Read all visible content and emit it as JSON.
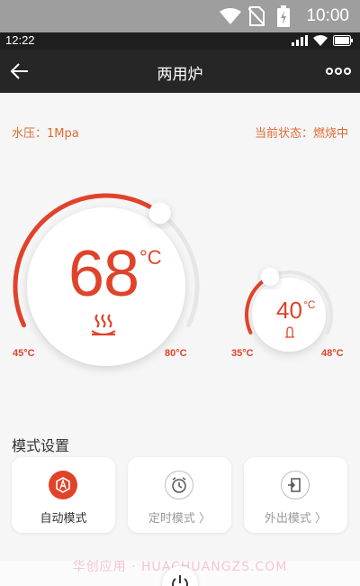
{
  "system_status": {
    "time": "10:00"
  },
  "app_status": {
    "time": "12:22"
  },
  "header": {
    "title": "两用炉"
  },
  "info": {
    "water_pressure": "水压：1Mpa",
    "current_status": "当前状态：燃烧中"
  },
  "heating_dial": {
    "temperature": "68",
    "unit": "°C",
    "min_label": "45°C",
    "max_label": "80°C",
    "min_value": 45,
    "max_value": 80,
    "value": 68
  },
  "water_dial": {
    "temperature": "40",
    "unit": "°C",
    "min_label": "35°C",
    "max_label": "48°C",
    "min_value": 35,
    "max_value": 48,
    "value": 40
  },
  "modes": {
    "title": "模式设置",
    "items": [
      {
        "label": "自动模式",
        "active": true
      },
      {
        "label": "定时模式 〉",
        "active": false
      },
      {
        "label": "外出模式 〉",
        "active": false
      }
    ]
  },
  "watermark": "华创应用 · HUACHUANGZS.COM",
  "colors": {
    "accent": "#e0432a",
    "header": "#262626",
    "background": "#f6f6f6"
  }
}
